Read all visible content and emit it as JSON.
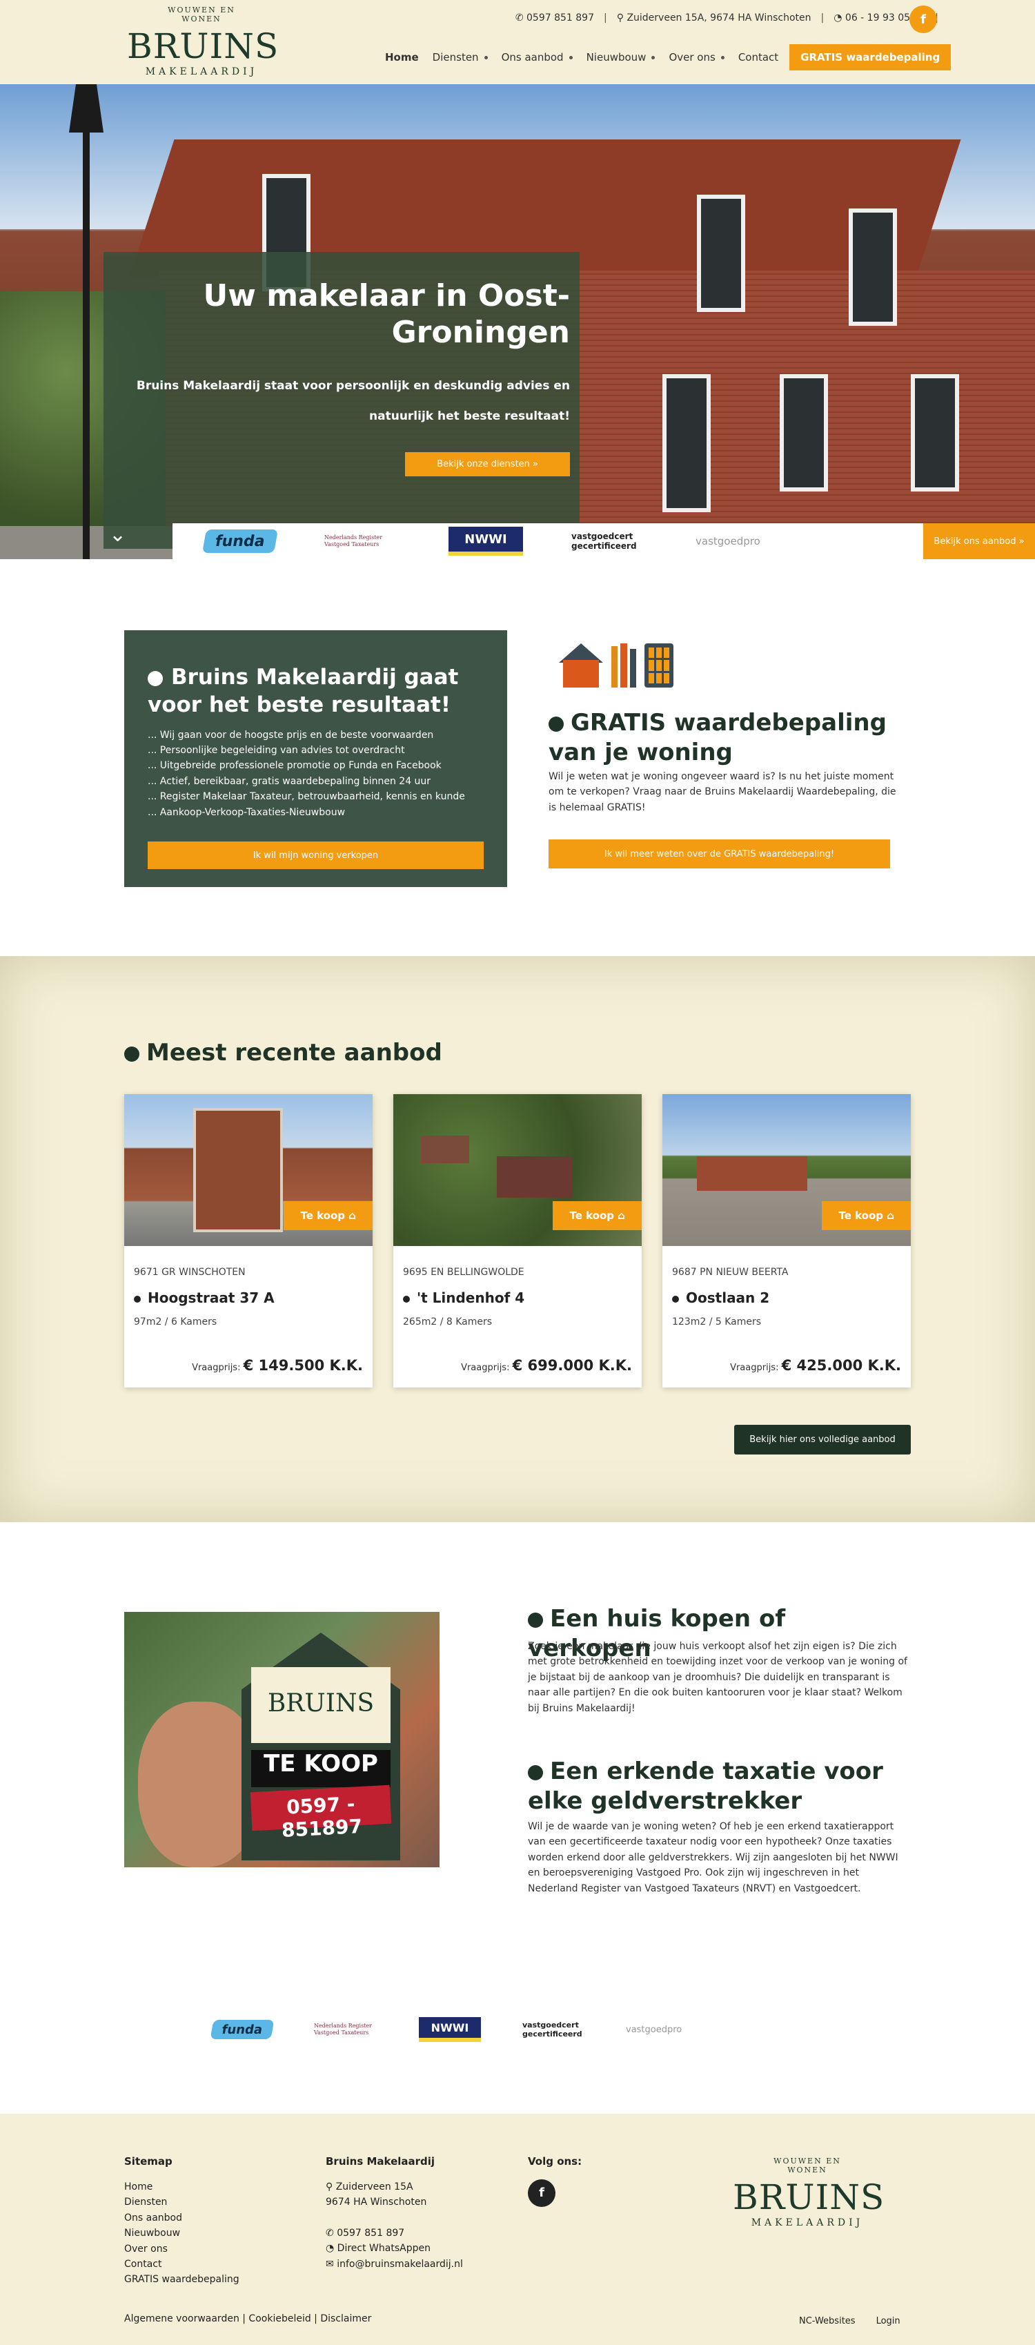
{
  "header": {
    "logo_arc": "WOUWEN EN WONEN",
    "logo_word": "BRUINS",
    "logo_sub": "MAKELAARDIJ",
    "phone": "0597 851 897",
    "address": "Zuiderveen 15A, 9674 HA Winschoten",
    "whatsapp": "06 - 19 93 05 51",
    "facebook": "f"
  },
  "nav": {
    "items": [
      "Home",
      "Diensten",
      "Ons aanbod",
      "Nieuwbouw",
      "Over ons",
      "Contact"
    ],
    "cta": "GRATIS waardebepaling"
  },
  "hero": {
    "title": "Uw makelaar in Oost-Groningen",
    "text": "Bruins Makelaardij staat voor persoonlijk en deskundig advies en natuurlijk het beste resultaat!",
    "button": "Bekijk onze diensten »",
    "scroll": "⌄",
    "cta_right": "Bekijk ons aanbod »"
  },
  "partners": {
    "funda": "funda",
    "nrvt": "Nederlands Register Vastgoed Taxateurs",
    "nwwi": "NWWI",
    "vastgoedcert": "vastgoedcert gecertificeerd",
    "vastgoedpro": "vastgoedpro"
  },
  "intro": {
    "title": "Bruins Makelaardij gaat voor het beste resultaat!",
    "items": [
      "... Wij gaan voor de hoogste prijs en de beste voorwaarden",
      "... Persoonlijke begeleiding van advies tot overdracht",
      "... Uitgebreide professionele promotie op Funda en Facebook",
      "... Actief, bereikbaar, gratis waardebepaling binnen 24 uur",
      "... Register Makelaar Taxateur, betrouwbaarheid, kennis en kunde",
      "... Aankoop-Verkoop-Taxaties-Nieuwbouw"
    ],
    "button": "Ik wil mijn woning verkopen"
  },
  "gratis": {
    "title": "GRATIS waardebepaling van je woning",
    "text": "Wil je weten wat je woning ongeveer waard is? Is nu het juiste moment om te verkopen? Vraag naar de Bruins Makelaardij Waardebepaling, die is helemaal GRATIS!",
    "button": "Ik wil meer weten over de GRATIS waardebepaling!"
  },
  "listings": {
    "title": "Meest recente aanbod",
    "tag": "Te koop",
    "price_label": "Vraagprijs:",
    "cards": [
      {
        "postcode": "9671 GR WINSCHOTEN",
        "address": "Hoogstraat 37 A",
        "meta": "97m2 / 6 Kamers",
        "price": "€ 149.500 K.K."
      },
      {
        "postcode": "9695 EN BELLINGWOLDE",
        "address": "'t Lindenhof 4",
        "meta": "265m2 / 8 Kamers",
        "price": "€ 699.000 K.K."
      },
      {
        "postcode": "9687 PN NIEUW BEERTA",
        "address": "Oostlaan 2",
        "meta": "123m2 / 5 Kamers",
        "price": "€ 425.000 K.K."
      }
    ],
    "all_button": "Bekijk hier ons volledige aanbod"
  },
  "about": {
    "photo_sign": "BRUINS",
    "photo_tekoop": "TE KOOP",
    "photo_phone": "0597 - 851897",
    "block1_title": "Een huis kopen of verkopen",
    "block1_text": "Zoek je een makelaar die jouw huis verkoopt alsof het zijn eigen is? Die zich met grote betrokkenheid en toewijding inzet voor de verkoop van je woning of je bijstaat bij de aankoop van je droomhuis? Die duidelijk en transparant is naar alle partijen? En die ook buiten kantooruren voor je klaar staat? Welkom bij Bruins Makelaardij!",
    "block2_title": "Een erkende taxatie voor elke geldverstrekker",
    "block2_text": "Wil je de waarde van je woning weten? Of heb je een erkend taxatierapport van een gecertificeerde taxateur nodig voor een hypotheek? Onze taxaties worden erkend door alle geldverstrekkers. Wij zijn aangesloten bij het NWWI en beroepsvereniging Vastgoed Pro. Ook zijn wij ingeschreven in het Nederland Register van Vastgoed Taxateurs (NRVT) en Vastgoedcert."
  },
  "footer": {
    "sitemap_title": "Sitemap",
    "sitemap": [
      "Home",
      "Diensten",
      "Ons aanbod",
      "Nieuwbouw",
      "Over ons",
      "Contact",
      "GRATIS waardebepaling"
    ],
    "company_title": "Bruins Makelaardij",
    "street": "Zuiderveen 15A",
    "city": "9674 HA Winschoten",
    "phone": "0597 851 897",
    "whatsapp": "Direct WhatsAppen",
    "email": "info@bruinsmakelaardij.nl",
    "follow_title": "Volg ons:",
    "legal": "Algemene voorwaarden | Cookiebeleid | Disclaimer",
    "nc": "NC-Websites",
    "login": "Login"
  },
  "colors": {
    "accent": "#f39c12",
    "dark_green": "#1f3326",
    "card_green": "#3d5446",
    "cream": "#f4efd6"
  }
}
